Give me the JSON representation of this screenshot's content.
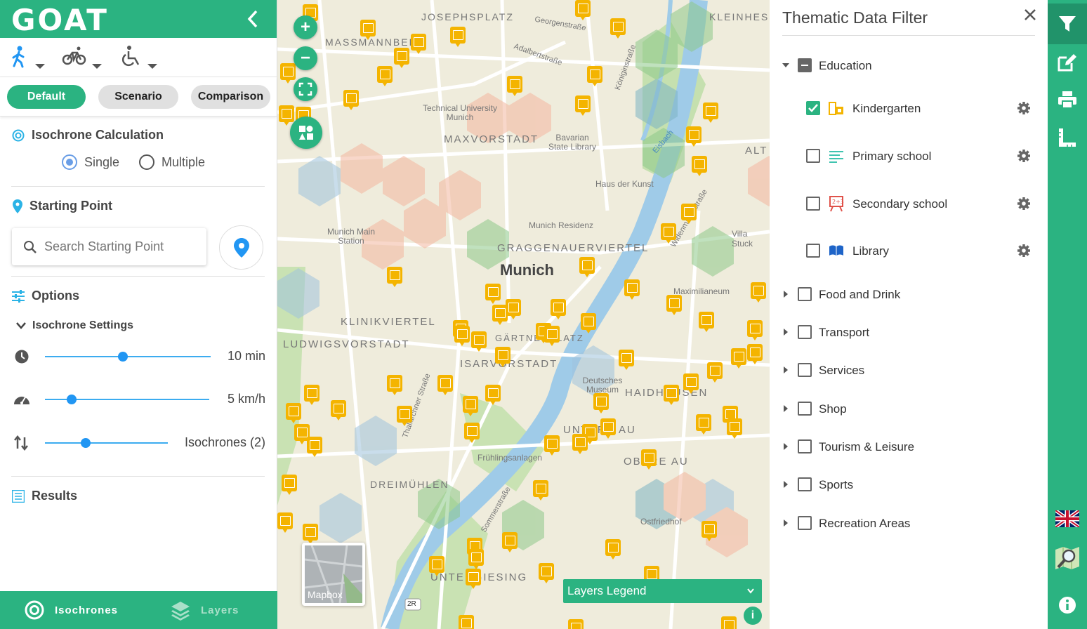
{
  "app": {
    "logo_text": "GOAT",
    "brand_color": "#2bb381"
  },
  "left_panel": {
    "travel_modes": [
      "walking-icon",
      "bicycle-icon",
      "wheelchair-icon"
    ],
    "tabs": [
      {
        "label": "Default",
        "active": true
      },
      {
        "label": "Scenario",
        "active": false
      },
      {
        "label": "Comparison",
        "active": false
      }
    ],
    "isochrone_calc": {
      "title": "Isochrone Calculation",
      "options": [
        {
          "label": "Single",
          "selected": true
        },
        {
          "label": "Multiple",
          "selected": false
        }
      ]
    },
    "starting_point": {
      "title": "Starting Point",
      "search_placeholder": "Search Starting Point"
    },
    "options": {
      "title": "Options",
      "settings_label": "Isochrone Settings",
      "sliders": [
        {
          "icon": "clock-icon",
          "value_label": "10 min",
          "fraction": 0.47
        },
        {
          "icon": "speedometer-icon",
          "value_label": "5 km/h",
          "fraction": 0.17
        },
        {
          "icon": "sort-icon",
          "value_label": "Isochrones (2)",
          "fraction": 0.33
        }
      ]
    },
    "results": {
      "title": "Results"
    },
    "bottom_nav": [
      {
        "label": "Isochrones",
        "active": true
      },
      {
        "label": "Layers",
        "active": false
      }
    ]
  },
  "map": {
    "city_label": "Munich",
    "district_labels": [
      "MAXVORSTADT",
      "GRAGGENAUERVIERTEL",
      "KLINIKVIERTEL",
      "LUDWIGSVORSTADT",
      "ISARVORSTADT",
      "GÄRTNERPLATZ",
      "DREIMÜHLEN",
      "UNTERGIESING",
      "HAIDHAUSEN",
      "OBERE AU",
      "UNTERE AU",
      "JOSEPHSPLATZ",
      "MASSMANNBERG",
      "KLEINHESSELOHE",
      "ALT"
    ],
    "place_labels": [
      "Technical University Munich",
      "Bavarian State Library",
      "Haus der Kunst",
      "Munich Residenz",
      "Munich Main Station",
      "Maximilianeum",
      "Deutsches Museum",
      "Frühlingsanlagen",
      "Ostfriedhof",
      "Villa Stuck"
    ],
    "street_labels": [
      "Georgenstraße",
      "Adalbertstraße",
      "Königinstraße",
      "Widenmayerstraße",
      "Sommerstraße",
      "Thalkirchner Straße",
      "Eisbach"
    ],
    "road_shield": "2R",
    "basemap_label": "Mapbox",
    "legend_label": "Layers Legend",
    "info_label": "i",
    "zoom_in": "+",
    "zoom_out": "−"
  },
  "filter_panel": {
    "title": "Thematic Data Filter",
    "groups": [
      {
        "label": "Education",
        "expanded": true,
        "state": "indeterminate",
        "items": [
          {
            "label": "Kindergarten",
            "checked": true,
            "icon": "kindergarten-icon"
          },
          {
            "label": "Primary school",
            "checked": false,
            "icon": "primary-school-icon"
          },
          {
            "label": "Secondary school",
            "checked": false,
            "icon": "secondary-school-icon"
          },
          {
            "label": "Library",
            "checked": false,
            "icon": "library-icon"
          }
        ]
      },
      {
        "label": "Food and Drink",
        "expanded": false
      },
      {
        "label": "Transport",
        "expanded": false
      },
      {
        "label": "Services",
        "expanded": false
      },
      {
        "label": "Shop",
        "expanded": false
      },
      {
        "label": "Tourism & Leisure",
        "expanded": false
      },
      {
        "label": "Sports",
        "expanded": false
      },
      {
        "label": "Recreation Areas",
        "expanded": false
      }
    ]
  },
  "right_sidebar": {
    "items": [
      "filter-icon",
      "edit-icon",
      "print-icon",
      "measure-icon"
    ],
    "bottom_items": [
      "uk-flag-icon",
      "map-search-icon",
      "info-icon"
    ]
  }
}
